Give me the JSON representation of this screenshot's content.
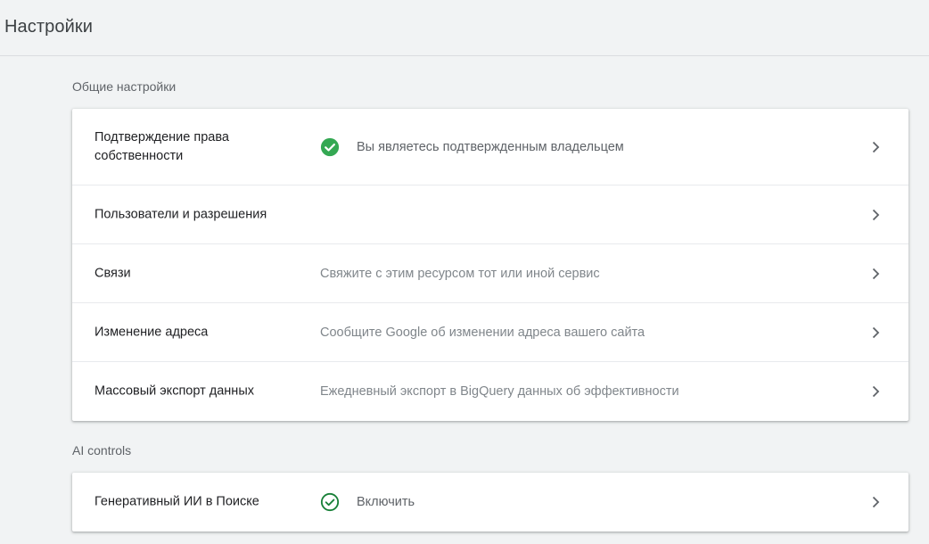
{
  "header": {
    "title": "Настройки"
  },
  "general": {
    "title": "Общие настройки",
    "rows": [
      {
        "label": "Подтверждение права собственности",
        "desc": "Вы являетесь подтвержденным владельцем",
        "status": "check-filled"
      },
      {
        "label": "Пользователи и разрешения",
        "desc": ""
      },
      {
        "label": "Связи",
        "desc": "Свяжите с этим ресурсом тот или иной сервис"
      },
      {
        "label": "Изменение адреса",
        "desc": "Сообщите Google об изменении адреса вашего сайта"
      },
      {
        "label": "Массовый экспорт данных",
        "desc": "Ежедневный экспорт в BigQuery данных об эффективности"
      }
    ]
  },
  "ai": {
    "title": "AI controls",
    "rows": [
      {
        "label": "Генеративный ИИ в Поиске",
        "desc": "Включить",
        "status": "check-outline"
      }
    ]
  },
  "colors": {
    "accent_green": "#34a853",
    "outline_green": "#188038"
  }
}
